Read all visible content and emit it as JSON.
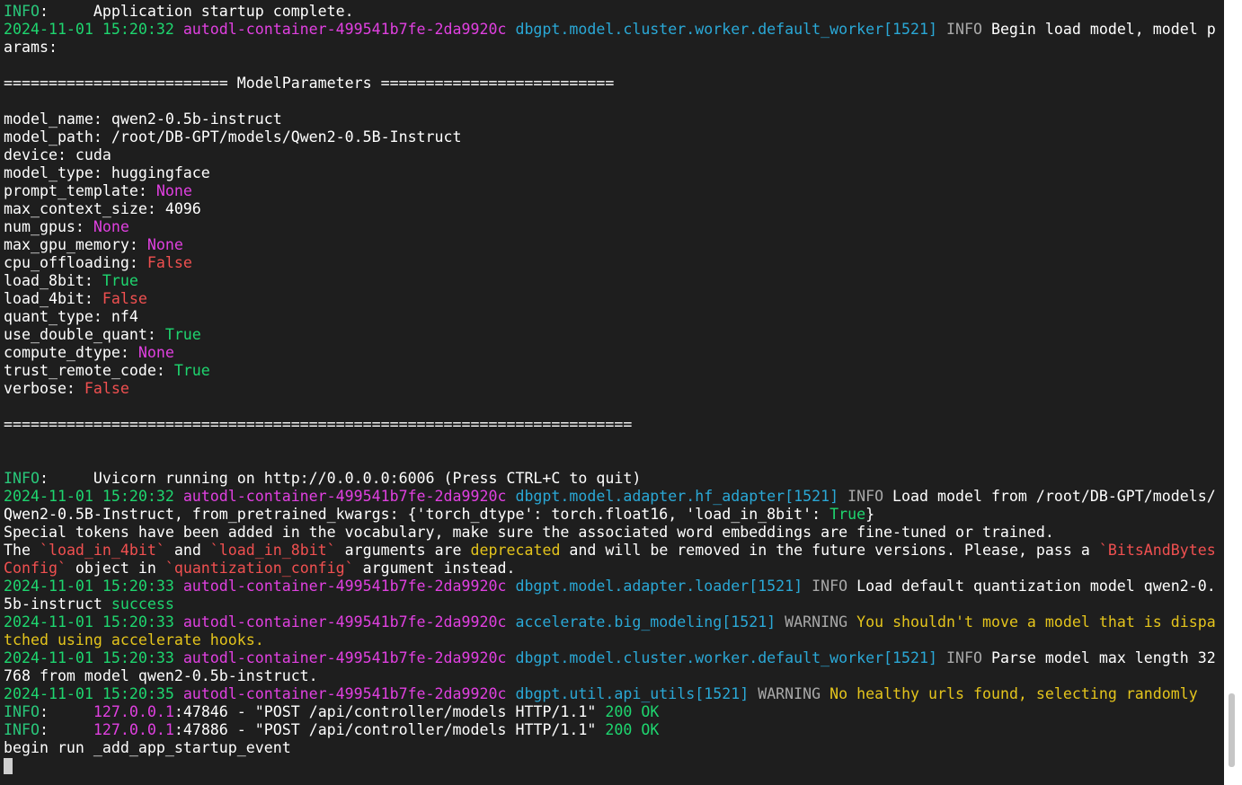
{
  "colors": {
    "background": "#1e1e1e",
    "date": "#1ed66f",
    "host": "#e040e0",
    "module": "#2aa8d6",
    "level": "#a8a8a8",
    "none_value": "#e040e0",
    "false_value": "#f05050",
    "true_value": "#1ed66f",
    "warning_text": "#e4c41c",
    "error_text": "#f05050",
    "scrollbar_track": "#ffffff",
    "scrollbar_thumb": "#c6c6c6",
    "cursor": "#cfcfcf"
  },
  "terminal": {
    "lines": [
      [
        {
          "t": "INFO",
          "c": "c-info"
        },
        {
          "t": ":     Application startup complete.",
          "c": "c-w"
        }
      ],
      [
        {
          "t": "2024-11-01 15:20:32 ",
          "c": "c-date"
        },
        {
          "t": "autodl-container-499541b7fe-2da9920c ",
          "c": "c-host"
        },
        {
          "t": "dbgpt.model.cluster.worker.default_worker[1521] ",
          "c": "c-mod"
        },
        {
          "t": "INFO ",
          "c": "c-gray"
        },
        {
          "t": "Begin load model, model p",
          "c": "c-w"
        }
      ],
      [
        {
          "t": "arams:",
          "c": "c-w"
        }
      ],
      [],
      [
        {
          "t": "========================= ModelParameters ==========================",
          "c": "c-w"
        }
      ],
      [],
      [
        {
          "t": "model_name: qwen2-0.5b-instruct",
          "c": "c-w"
        }
      ],
      [
        {
          "t": "model_path: /root/DB-GPT/models/Qwen2-0.5B-Instruct",
          "c": "c-w"
        }
      ],
      [
        {
          "t": "device: cuda",
          "c": "c-w"
        }
      ],
      [
        {
          "t": "model_type: huggingface",
          "c": "c-w"
        }
      ],
      [
        {
          "t": "prompt_template: ",
          "c": "c-w"
        },
        {
          "t": "None",
          "c": "c-none"
        }
      ],
      [
        {
          "t": "max_context_size: 4096",
          "c": "c-w"
        }
      ],
      [
        {
          "t": "num_gpus: ",
          "c": "c-w"
        },
        {
          "t": "None",
          "c": "c-none"
        }
      ],
      [
        {
          "t": "max_gpu_memory: ",
          "c": "c-w"
        },
        {
          "t": "None",
          "c": "c-none"
        }
      ],
      [
        {
          "t": "cpu_offloading: ",
          "c": "c-w"
        },
        {
          "t": "False",
          "c": "c-false"
        }
      ],
      [
        {
          "t": "load_8bit: ",
          "c": "c-w"
        },
        {
          "t": "True",
          "c": "c-true"
        }
      ],
      [
        {
          "t": "load_4bit: ",
          "c": "c-w"
        },
        {
          "t": "False",
          "c": "c-false"
        }
      ],
      [
        {
          "t": "quant_type: nf4",
          "c": "c-w"
        }
      ],
      [
        {
          "t": "use_double_quant: ",
          "c": "c-w"
        },
        {
          "t": "True",
          "c": "c-true"
        }
      ],
      [
        {
          "t": "compute_dtype: ",
          "c": "c-w"
        },
        {
          "t": "None",
          "c": "c-none"
        }
      ],
      [
        {
          "t": "trust_remote_code: ",
          "c": "c-w"
        },
        {
          "t": "True",
          "c": "c-true"
        }
      ],
      [
        {
          "t": "verbose: ",
          "c": "c-w"
        },
        {
          "t": "False",
          "c": "c-false"
        }
      ],
      [],
      [
        {
          "t": "======================================================================",
          "c": "c-w"
        }
      ],
      [],
      [],
      [
        {
          "t": "INFO",
          "c": "c-info"
        },
        {
          "t": ":     Uvicorn running on http://0.0.0.0:6006 (Press CTRL+C to quit)",
          "c": "c-w"
        }
      ],
      [
        {
          "t": "2024-11-01 15:20:32 ",
          "c": "c-date"
        },
        {
          "t": "autodl-container-499541b7fe-2da9920c ",
          "c": "c-host"
        },
        {
          "t": "dbgpt.model.adapter.hf_adapter[1521] ",
          "c": "c-mod"
        },
        {
          "t": "INFO ",
          "c": "c-gray"
        },
        {
          "t": "Load model from /root/DB-GPT/models/",
          "c": "c-w"
        }
      ],
      [
        {
          "t": "Qwen2-0.5B-Instruct, from_pretrained_kwargs: {'torch_dtype': torch.float16, 'load_in_8bit': ",
          "c": "c-w"
        },
        {
          "t": "True",
          "c": "c-true"
        },
        {
          "t": "}",
          "c": "c-w"
        }
      ],
      [
        {
          "t": "Special tokens have been added in the vocabulary, make sure the associated word embeddings are fine-tuned or trained.",
          "c": "c-w"
        }
      ],
      [
        {
          "t": "The ",
          "c": "c-w"
        },
        {
          "t": "`load_in_4bit`",
          "c": "c-red"
        },
        {
          "t": " and ",
          "c": "c-w"
        },
        {
          "t": "`load_in_8bit`",
          "c": "c-red"
        },
        {
          "t": " arguments are ",
          "c": "c-w"
        },
        {
          "t": "deprecated",
          "c": "c-yel"
        },
        {
          "t": " and will be removed in the future versions. Please, pass a ",
          "c": "c-w"
        },
        {
          "t": "`BitsAndBytes",
          "c": "c-red"
        }
      ],
      [
        {
          "t": "Config`",
          "c": "c-red"
        },
        {
          "t": " object in ",
          "c": "c-w"
        },
        {
          "t": "`quantization_config`",
          "c": "c-red"
        },
        {
          "t": " argument instead.",
          "c": "c-w"
        }
      ],
      [
        {
          "t": "2024-11-01 15:20:33 ",
          "c": "c-date"
        },
        {
          "t": "autodl-container-499541b7fe-2da9920c ",
          "c": "c-host"
        },
        {
          "t": "dbgpt.model.adapter.loader[1521] ",
          "c": "c-mod"
        },
        {
          "t": "INFO ",
          "c": "c-gray"
        },
        {
          "t": "Load default quantization model qwen2-0.",
          "c": "c-w"
        }
      ],
      [
        {
          "t": "5b-instruct ",
          "c": "c-w"
        },
        {
          "t": "success",
          "c": "c-green"
        }
      ],
      [
        {
          "t": "2024-11-01 15:20:33 ",
          "c": "c-date"
        },
        {
          "t": "autodl-container-499541b7fe-2da9920c ",
          "c": "c-host"
        },
        {
          "t": "accelerate.big_modeling[1521] ",
          "c": "c-mod"
        },
        {
          "t": "WARNING ",
          "c": "c-gray"
        },
        {
          "t": "You shouldn't move a model that is dispa",
          "c": "c-yel"
        }
      ],
      [
        {
          "t": "tched using accelerate hooks.",
          "c": "c-yel"
        }
      ],
      [
        {
          "t": "2024-11-01 15:20:33 ",
          "c": "c-date"
        },
        {
          "t": "autodl-container-499541b7fe-2da9920c ",
          "c": "c-host"
        },
        {
          "t": "dbgpt.model.cluster.worker.default_worker[1521] ",
          "c": "c-mod"
        },
        {
          "t": "INFO ",
          "c": "c-gray"
        },
        {
          "t": "Parse model max length 32",
          "c": "c-w"
        }
      ],
      [
        {
          "t": "768 from model qwen2-0.5b-instruct.",
          "c": "c-w"
        }
      ],
      [
        {
          "t": "2024-11-01 15:20:35 ",
          "c": "c-date"
        },
        {
          "t": "autodl-container-499541b7fe-2da9920c ",
          "c": "c-host"
        },
        {
          "t": "dbgpt.util.api_utils[1521] ",
          "c": "c-mod"
        },
        {
          "t": "WARNING ",
          "c": "c-gray"
        },
        {
          "t": "No healthy urls found, selecting randomly",
          "c": "c-yel"
        }
      ],
      [
        {
          "t": "INFO",
          "c": "c-info"
        },
        {
          "t": ":     ",
          "c": "c-w"
        },
        {
          "t": "127.0.0.1",
          "c": "c-ip"
        },
        {
          "t": ":47846 - \"POST /api/controller/models HTTP/1.1\" ",
          "c": "c-w"
        },
        {
          "t": "200 OK",
          "c": "c-200"
        }
      ],
      [
        {
          "t": "INFO",
          "c": "c-info"
        },
        {
          "t": ":     ",
          "c": "c-w"
        },
        {
          "t": "127.0.0.1",
          "c": "c-ip"
        },
        {
          "t": ":47886 - \"POST /api/controller/models HTTP/1.1\" ",
          "c": "c-w"
        },
        {
          "t": "200 OK",
          "c": "c-200"
        }
      ],
      [
        {
          "t": "begin run _add_app_startup_event",
          "c": "c-w"
        }
      ]
    ]
  }
}
